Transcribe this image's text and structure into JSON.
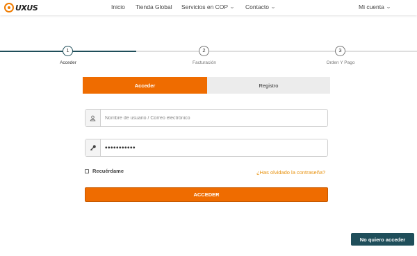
{
  "brand": {
    "logo_text": "UXUS",
    "accent": "#ef6c00",
    "dark": "#1f4e5a"
  },
  "nav": {
    "items": [
      {
        "label": "Inicio"
      },
      {
        "label": "Tienda Global"
      },
      {
        "label": "Servicios en COP",
        "has_dropdown": true
      },
      {
        "label": "Contacto",
        "has_dropdown": true
      }
    ],
    "account": {
      "label": "Mi cuenta",
      "has_dropdown": true
    }
  },
  "steps": [
    {
      "number": "1",
      "label": "Acceder",
      "active": true
    },
    {
      "number": "2",
      "label": "Facturación",
      "active": false
    },
    {
      "number": "3",
      "label": "Orden Y Pago",
      "active": false
    }
  ],
  "tabs": {
    "login": "Acceder",
    "register": "Registro"
  },
  "form": {
    "username_placeholder": "Nombre de usuario / Correo electrónico",
    "username_value": "",
    "password_value": "•••••••••••",
    "remember_label": "Recuérdame",
    "remember_checked": false,
    "forgot_label": "¿Has olvidado la contraseña?",
    "submit_label": "ACCEDER"
  },
  "no_access_label": "No quiero acceder",
  "icons": {
    "user": "user-icon",
    "password": "key-icon"
  }
}
